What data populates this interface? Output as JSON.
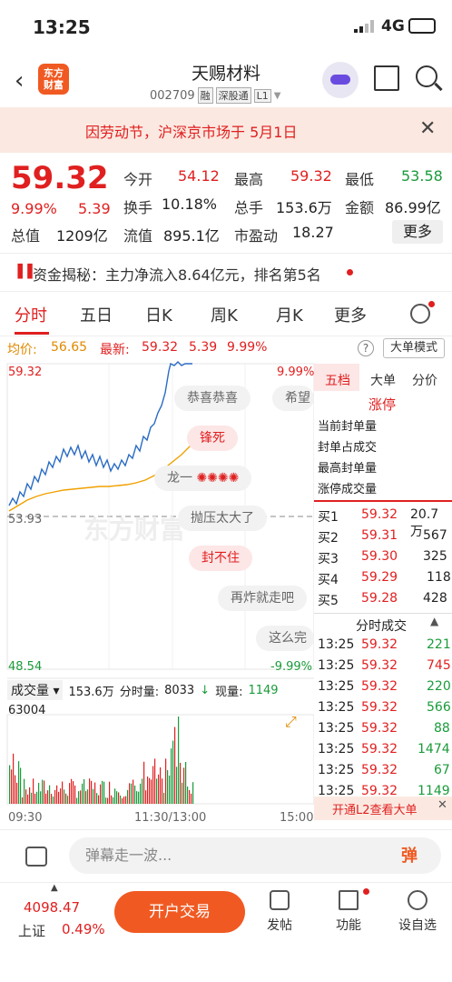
{
  "status_bar": {
    "time": "13:25",
    "network": "4G"
  },
  "header": {
    "stock_name": "天赐材料",
    "stock_code": "002709",
    "tags": [
      "融",
      "深股通",
      "L1"
    ],
    "logo_text": "东方财富"
  },
  "notice": {
    "text": "因劳动节，沪深京市场于 5月1日"
  },
  "quote": {
    "price": "59.32",
    "change_pct": "9.99%",
    "change_amt": "5.39",
    "fields": [
      {
        "label": "今开",
        "value": "54.12",
        "color": "red"
      },
      {
        "label": "最高",
        "value": "59.32",
        "color": "red"
      },
      {
        "label": "最低",
        "value": "53.58",
        "color": "green"
      },
      {
        "label": "换手",
        "value": "10.18%",
        "color": "dark"
      },
      {
        "label": "总手",
        "value": "153.6万",
        "color": "dark"
      },
      {
        "label": "金额",
        "value": "86.99亿",
        "color": "dark"
      },
      {
        "label": "总值",
        "value": "1209亿",
        "color": "dark"
      },
      {
        "label": "流值",
        "value": "895.1亿",
        "color": "dark"
      },
      {
        "label": "市盈动",
        "value": "18.27",
        "color": "dark"
      }
    ],
    "more_label": "更多"
  },
  "capital_flow": {
    "text": "资金揭秘：主力净流入8.64亿元，排名第5名"
  },
  "tabs": [
    "分时",
    "五日",
    "日K",
    "周K",
    "月K",
    "更多"
  ],
  "legend": {
    "avg_label": "均价:",
    "avg_value": "56.65",
    "latest_label": "最新:",
    "latest_value": "59.32",
    "latest_chg": "5.39",
    "latest_pct": "9.99%",
    "mode_label": "大单模式"
  },
  "chart": {
    "top_price": "59.32",
    "top_pct": "9.99%",
    "mid_price": "53.93",
    "bottom_price": "48.54",
    "bottom_pct": "-9.99%",
    "volume_label": "成交量",
    "volume_total": "153.6万",
    "time_volume_label": "分时量:",
    "time_volume": "8033",
    "current_volume_label": "现量:",
    "current_volume": "1149",
    "volume_max": "63004",
    "time_start": "09:30",
    "time_mid": "11:30/13:00",
    "time_end": "15:00",
    "watermark": "东方财富"
  },
  "danmu": [
    {
      "text": "恭喜恭喜",
      "style": "gray"
    },
    {
      "text": "希望",
      "style": "gray"
    },
    {
      "text": "锋死",
      "style": "red"
    },
    {
      "text": "龙一",
      "style": "gray"
    },
    {
      "text": "抛压太大了",
      "style": "gray"
    },
    {
      "text": "封不住",
      "style": "red"
    },
    {
      "text": "再炸就走吧",
      "style": "gray"
    },
    {
      "text": "这么完",
      "style": "gray"
    }
  ],
  "order_book": {
    "tabs": [
      "五档",
      "大单",
      "分价"
    ],
    "limit_label": "涨停",
    "limit_fields": [
      "当前封单量",
      "封单占成交",
      "最高封单量",
      "涨停成交量"
    ],
    "bids": [
      {
        "label": "买1",
        "price": "59.32",
        "volume": "20.7万"
      },
      {
        "label": "买2",
        "price": "59.31",
        "volume": "567"
      },
      {
        "label": "买3",
        "price": "59.30",
        "volume": "325"
      },
      {
        "label": "买4",
        "price": "59.29",
        "volume": "118"
      },
      {
        "label": "买5",
        "price": "59.28",
        "volume": "428"
      }
    ],
    "ticks_label": "分时成交",
    "ticks": [
      {
        "time": "13:25",
        "price": "59.32",
        "volume": "221"
      },
      {
        "time": "13:25",
        "price": "59.32",
        "volume": "745"
      },
      {
        "time": "13:25",
        "price": "59.32",
        "volume": "220"
      },
      {
        "time": "13:25",
        "price": "59.32",
        "volume": "566"
      },
      {
        "time": "13:25",
        "price": "59.32",
        "volume": "88"
      },
      {
        "time": "13:25",
        "price": "59.32",
        "volume": "1474"
      },
      {
        "time": "13:25",
        "price": "59.32",
        "volume": "67"
      },
      {
        "time": "13:25",
        "price": "59.32",
        "volume": "1149"
      }
    ],
    "l2_banner": "开通L2查看大单"
  },
  "danmu_input": {
    "placeholder": "弹幕走一波...",
    "toggle": "弹"
  },
  "bottom_nav": {
    "index_value": "4098.47",
    "index_name": "上证",
    "index_pct": "0.49%",
    "trade_label": "开户交易",
    "items": [
      "发帖",
      "功能",
      "设自选"
    ]
  }
}
